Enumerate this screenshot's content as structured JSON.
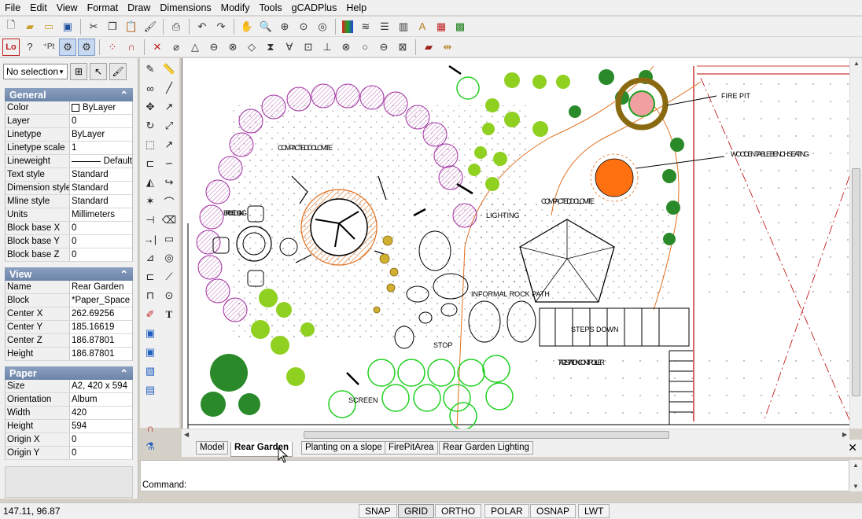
{
  "menu": [
    "File",
    "Edit",
    "View",
    "Format",
    "Draw",
    "Dimensions",
    "Modify",
    "Tools",
    "gCADPlus",
    "Help"
  ],
  "toolbar1": [
    "new-icon",
    "open-icon",
    "open-folder-icon",
    "save-icon",
    "|",
    "cut-icon",
    "copy-icon",
    "paste-icon",
    "paint-icon",
    "|",
    "print-icon",
    "|",
    "undo-icon",
    "redo-icon",
    "|",
    "pan-icon",
    "zoom-in-icon",
    "zoom-window-icon",
    "zoom-extents-icon",
    "zoom-all-icon",
    "|",
    "color-icon",
    "layers-icon",
    "linetypes-icon",
    "columns-icon",
    "text-style-icon",
    "dimension-style-icon",
    "image-icon"
  ],
  "toolbar1_extra_labels": {
    "lo_badge": "Lo"
  },
  "selection": {
    "value": "No selection"
  },
  "sections": {
    "general": {
      "title": "General",
      "rows": [
        {
          "k": "Color",
          "v": "ByLayer"
        },
        {
          "k": "Layer",
          "v": "0"
        },
        {
          "k": "Linetype",
          "v": "ByLayer"
        },
        {
          "k": "Linetype scale",
          "v": "1"
        },
        {
          "k": "Lineweight",
          "v": "Default"
        },
        {
          "k": "Text style",
          "v": "Standard"
        },
        {
          "k": "Dimension style",
          "v": "Standard"
        },
        {
          "k": "Mline style",
          "v": "Standard"
        },
        {
          "k": "Units",
          "v": "Millimeters"
        },
        {
          "k": "Block base X",
          "v": "0"
        },
        {
          "k": "Block base Y",
          "v": "0"
        },
        {
          "k": "Block base Z",
          "v": "0"
        }
      ]
    },
    "view": {
      "title": "View",
      "rows": [
        {
          "k": "Name",
          "v": "Rear Garden"
        },
        {
          "k": "Block",
          "v": "*Paper_Space"
        },
        {
          "k": "Center X",
          "v": "262.69256"
        },
        {
          "k": "Center Y",
          "v": "185.16619"
        },
        {
          "k": "Center Z",
          "v": "186.87801"
        },
        {
          "k": "Height",
          "v": "186.87801"
        }
      ]
    },
    "paper": {
      "title": "Paper",
      "rows": [
        {
          "k": "Size",
          "v": "A2, 420 x 594"
        },
        {
          "k": "Orientation",
          "v": "Album"
        },
        {
          "k": "Width",
          "v": "420"
        },
        {
          "k": "Height",
          "v": "594"
        },
        {
          "k": "Origin X",
          "v": "0"
        },
        {
          "k": "Origin Y",
          "v": "0"
        }
      ]
    }
  },
  "drawing_labels": {
    "compacted1": "COMPACTED DOLOMITE",
    "compacted2": "COMPACTED DOLOMITE",
    "brick": "BRICK EDGING",
    "lighting": "LIGHTING",
    "rockpath": "INFORMAL ROCK PATH",
    "steps": "STEPS DOWN",
    "stop": "STOP",
    "tap": "TAP 2STATION CONTROLLER",
    "screen": "SCREEN",
    "firepit": "FIRE PIT",
    "bench": "WOODEN TABLE BENCH SEATING"
  },
  "tabs": [
    {
      "label": "Model",
      "active": false
    },
    {
      "label": "Rear Garden",
      "active": true
    },
    {
      "label": "Planting on a slope",
      "active": false
    },
    {
      "label": "FirePitArea",
      "active": false
    },
    {
      "label": "Rear Garden Lighting",
      "active": false
    }
  ],
  "command": {
    "label": "Command:"
  },
  "status": {
    "coords": "147.11, 96.87",
    "toggles": [
      "SNAP",
      "GRID",
      "ORTHO",
      "POLAR",
      "OSNAP",
      "LWT"
    ]
  }
}
